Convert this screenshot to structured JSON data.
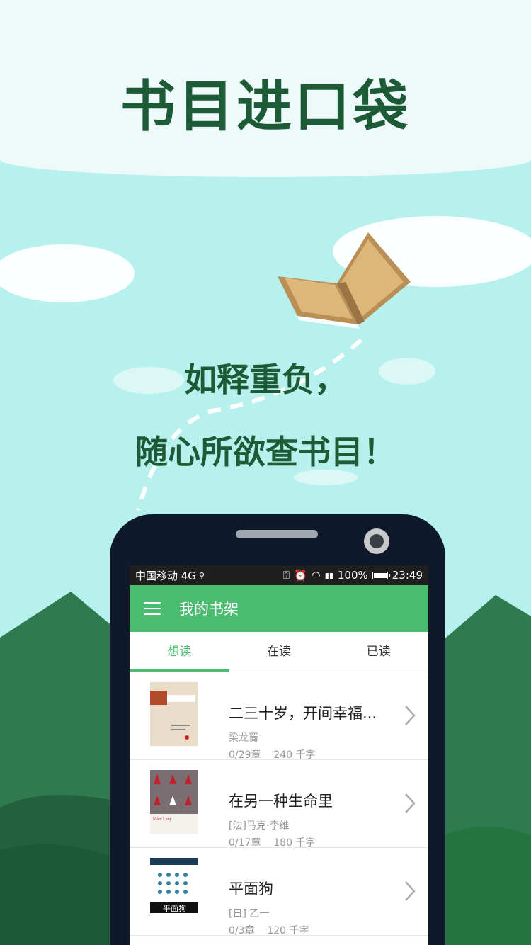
{
  "hero": {
    "title": "书目进口袋",
    "tagline_line1": "如释重负，",
    "tagline_line2": "随心所欲查书目！"
  },
  "status_bar": {
    "carrier": "中国移动 4G",
    "battery": "100%",
    "battery_level": 1.0,
    "time": "23:49",
    "icons": [
      "search-icon",
      "vibrate-icon",
      "alarm-icon",
      "wifi-icon",
      "signal-4g-icon",
      "battery-icon"
    ]
  },
  "app_bar": {
    "menu_icon": "menu-icon",
    "title": "我的书架"
  },
  "tabs": [
    {
      "label": "想读",
      "active": true
    },
    {
      "label": "在读",
      "active": false
    },
    {
      "label": "已读",
      "active": false
    }
  ],
  "books": [
    {
      "title": "二三十岁，开间幸福...",
      "author": "梁龙蜀",
      "chapters": "0/29章",
      "words": "240 千字"
    },
    {
      "title": "在另一种生命里",
      "author": "[法]马克·李维",
      "chapters": "0/17章",
      "words": "180 千字",
      "cover_text": "Marc Levy"
    },
    {
      "title": "平面狗",
      "author": "[日] 乙一",
      "chapters": "0/3章",
      "words": "120 千字",
      "cover_text": "平面狗"
    }
  ],
  "colors": {
    "brand_green": "#4cbc71",
    "title_green": "#1c5b36",
    "sky": "#b7f1ee"
  }
}
